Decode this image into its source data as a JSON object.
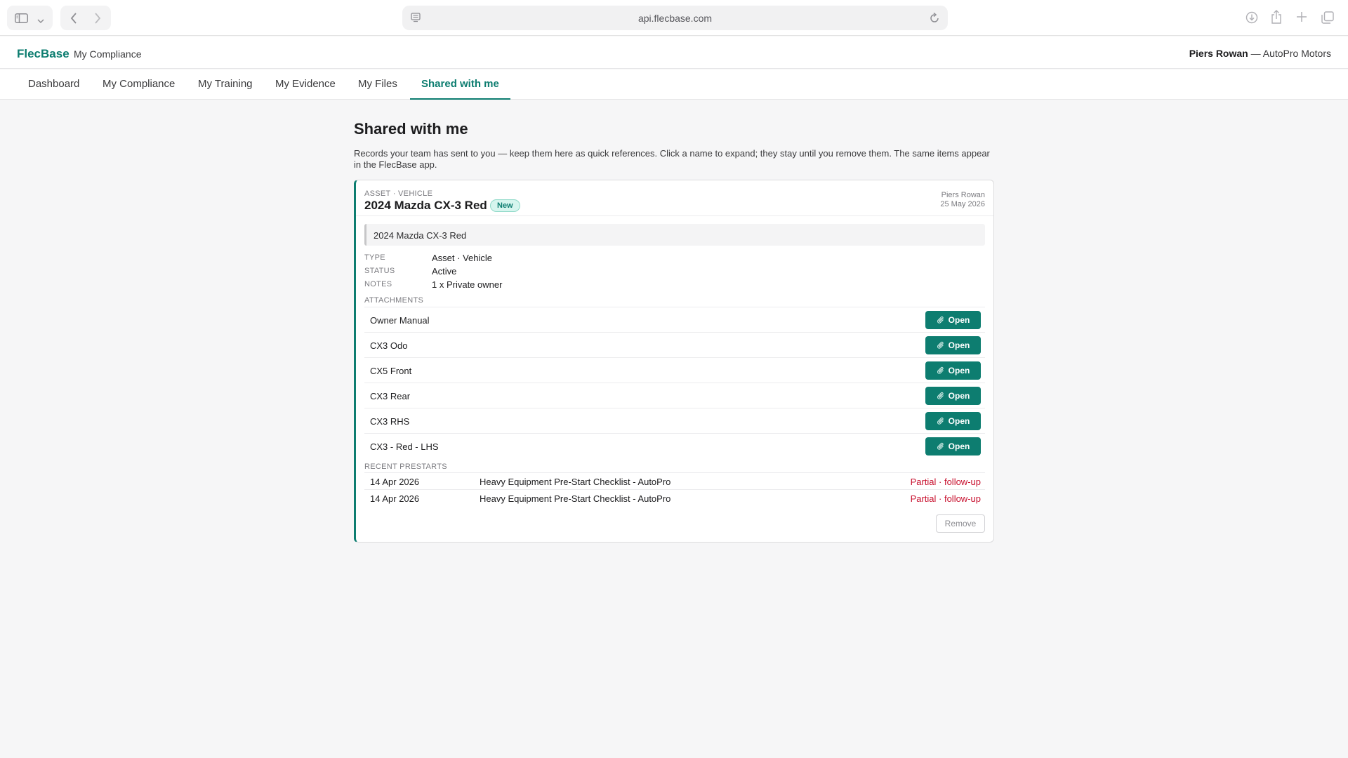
{
  "browser": {
    "url": "api.flecbase.com"
  },
  "header": {
    "brand": "FlecBase",
    "section": "My Compliance",
    "user_name": "Piers Rowan",
    "user_org": " — AutoPro Motors"
  },
  "tabs": [
    {
      "label": "Dashboard"
    },
    {
      "label": "My Compliance"
    },
    {
      "label": "My Training"
    },
    {
      "label": "My Evidence"
    },
    {
      "label": "My Files"
    },
    {
      "label": "Shared with me",
      "active": true
    }
  ],
  "page": {
    "title": "Shared with me",
    "intro": "Records your team has sent to you — keep them here as quick references. Click a name to expand; they stay until you remove them. The same items appear in the FlecBase app."
  },
  "record": {
    "kind": "ASSET · VEHICLE",
    "title": "2024 Mazda CX-3 Red",
    "badge": "New",
    "shared_by": "Piers Rowan",
    "shared_date": "25 May 2026",
    "summary": "2024 Mazda CX-3 Red",
    "fields": {
      "type_label": "TYPE",
      "type_value": "Asset · Vehicle",
      "status_label": "STATUS",
      "status_value": "Active",
      "notes_label": "NOTES",
      "notes_value": "1 x Private owner"
    },
    "attachments_label": "ATTACHMENTS",
    "open_label": "Open",
    "attachments": [
      {
        "name": "Owner Manual"
      },
      {
        "name": "CX3 Odo"
      },
      {
        "name": "CX5 Front"
      },
      {
        "name": "CX3 Rear"
      },
      {
        "name": "CX3 RHS"
      },
      {
        "name": "CX3 - Red - LHS"
      }
    ],
    "prestarts_label": "RECENT PRESTARTS",
    "prestarts": [
      {
        "date": "14 Apr 2026",
        "name": "Heavy Equipment Pre-Start Checklist - AutoPro",
        "status": "Partial · follow-up"
      },
      {
        "date": "14 Apr 2026",
        "name": "Heavy Equipment Pre-Start Checklist - AutoPro",
        "status": "Partial · follow-up"
      }
    ],
    "remove_label": "Remove"
  },
  "colors": {
    "accent": "#0d7d70",
    "warning": "#c8102e",
    "background": "#f6f6f7"
  },
  "icons": [
    "sidebar-icon",
    "chevron-down-icon",
    "back-icon",
    "forward-icon",
    "page-icon",
    "reload-icon",
    "download-icon",
    "share-icon",
    "new-tab-icon",
    "tabs-overview-icon",
    "paperclip-icon"
  ]
}
